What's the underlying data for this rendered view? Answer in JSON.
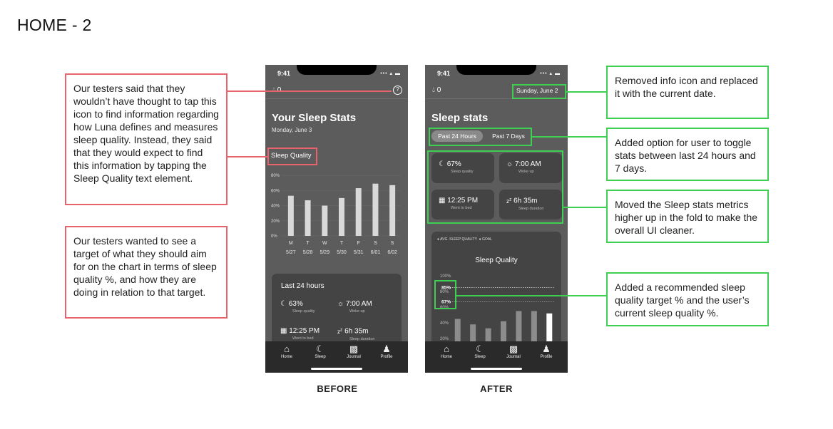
{
  "page": {
    "title": "HOME - 2"
  },
  "notes": {
    "left1": "Our testers said that they wouldn’t have thought to tap this icon to find information regarding how Luna defines and measures sleep quality. Instead, they said that they would expect to find this information by tapping the Sleep Quality text element.",
    "left2": "Our testers wanted to see a target of what they should aim for on the chart in terms of sleep quality %, and how they are doing in relation to that target.",
    "right1": "Removed info icon and replaced it with the current date.",
    "right2": "Added option for user to toggle stats between last 24 hours and 7 days.",
    "right3": "Moved the Sleep stats metrics higher up in the fold to make the overall UI cleaner.",
    "right4": "Added a recommended sleep quality target % and the user’s current sleep quality %."
  },
  "captions": {
    "before": "BEFORE",
    "after": "AFTER"
  },
  "status": {
    "time": "9:41",
    "icons": "••• ▴ ▬"
  },
  "before": {
    "drops": "0",
    "help_icon": "?",
    "title": "Your Sleep Stats",
    "date": "Monday, June 3",
    "chart_label": "Sleep Quality",
    "card_title": "Last 24 hours",
    "metrics": [
      {
        "value": "63%",
        "label": "Sleep quality"
      },
      {
        "value": "7:00 AM",
        "label": "Woke up"
      },
      {
        "value": "12:25 PM",
        "label": "Went to bed"
      },
      {
        "value": "6h 35m",
        "label": "Sleep duration"
      }
    ]
  },
  "after": {
    "drops": "0",
    "date": "Sunday, June 2",
    "title": "Sleep stats",
    "toggle": [
      "Past 24 Hours",
      "Past 7 Days"
    ],
    "metrics": [
      {
        "value": "67%",
        "label": "Sleep quality"
      },
      {
        "value": "7:00 AM",
        "label": "Woke up"
      },
      {
        "value": "12:25 PM",
        "label": "Went to bed"
      },
      {
        "value": "6h 35m",
        "label": "Sleep duration"
      }
    ],
    "legend": [
      "AVG. SLEEP QUALITY",
      "GOAL"
    ],
    "chart_title": "Sleep Quality",
    "target_label": "85%",
    "current_label": "67%"
  },
  "nav": [
    "Home",
    "Sleep",
    "Journal",
    "Profile"
  ],
  "chart_data": [
    {
      "type": "bar",
      "title": "Sleep Quality",
      "categories": [
        "M",
        "T",
        "W",
        "T",
        "F",
        "S",
        "S"
      ],
      "category_dates": [
        "5/27",
        "5/28",
        "5/29",
        "5/30",
        "5/31",
        "6/01",
        "6/02"
      ],
      "values": [
        53,
        47,
        40,
        50,
        63,
        69,
        67
      ],
      "ylim": [
        0,
        80
      ],
      "yticks": [
        "0%",
        "20%",
        "40%",
        "60%",
        "80%"
      ],
      "color": "#d9d9d9"
    },
    {
      "type": "bar",
      "title": "Sleep Quality",
      "values": [
        45,
        38,
        33,
        42,
        55,
        55,
        52
      ],
      "ylim": [
        20,
        100
      ],
      "yticks": [
        "20%",
        "40%",
        "60%",
        "80%",
        "100%"
      ],
      "goal": 85,
      "current": 67,
      "color": "#8c8c8c",
      "highlight_color": "#ffffff"
    }
  ],
  "colors": {
    "red": "#e8636b",
    "green": "#3fcf52"
  }
}
